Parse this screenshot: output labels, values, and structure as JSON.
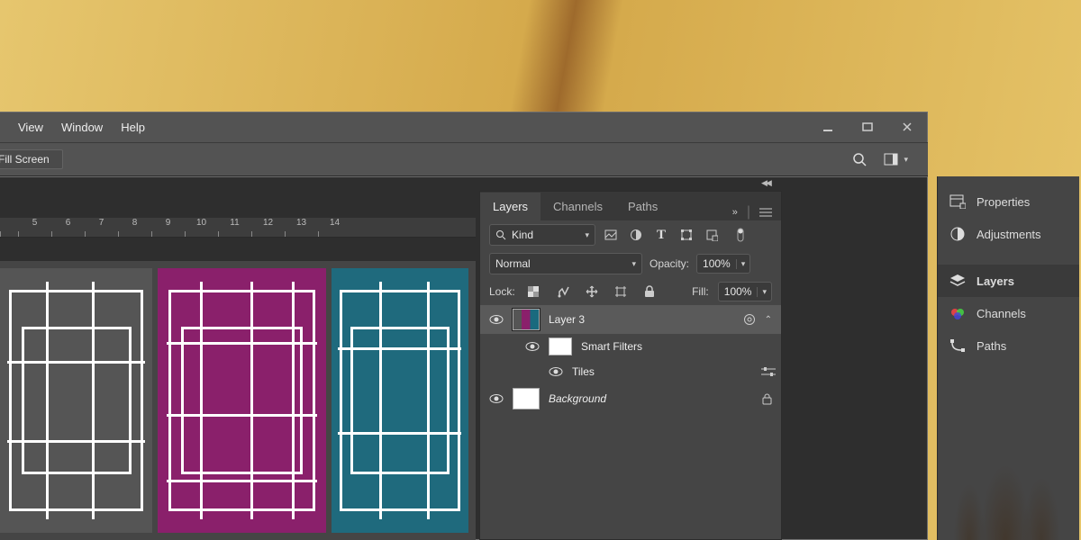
{
  "menu": {
    "view": "View",
    "window": "Window",
    "help": "Help"
  },
  "options": {
    "fill_screen": "Fill Screen"
  },
  "ruler": {
    "ticks": [
      "",
      "5",
      "6",
      "7",
      "8",
      "9",
      "10",
      "11",
      "12",
      "13",
      "14"
    ]
  },
  "rightpanels": {
    "properties": "Properties",
    "adjustments": "Adjustments",
    "layers": "Layers",
    "channels": "Channels",
    "paths": "Paths"
  },
  "layers_panel": {
    "tabs": {
      "layers": "Layers",
      "channels": "Channels",
      "paths": "Paths"
    },
    "filter_kind": "Kind",
    "blend_mode": "Normal",
    "opacity_label": "Opacity:",
    "opacity_value": "100%",
    "lock_label": "Lock:",
    "fill_label": "Fill:",
    "fill_value": "100%",
    "items": {
      "layer3": "Layer 3",
      "smart_filters": "Smart Filters",
      "tiles": "Tiles",
      "background": "Background"
    }
  }
}
